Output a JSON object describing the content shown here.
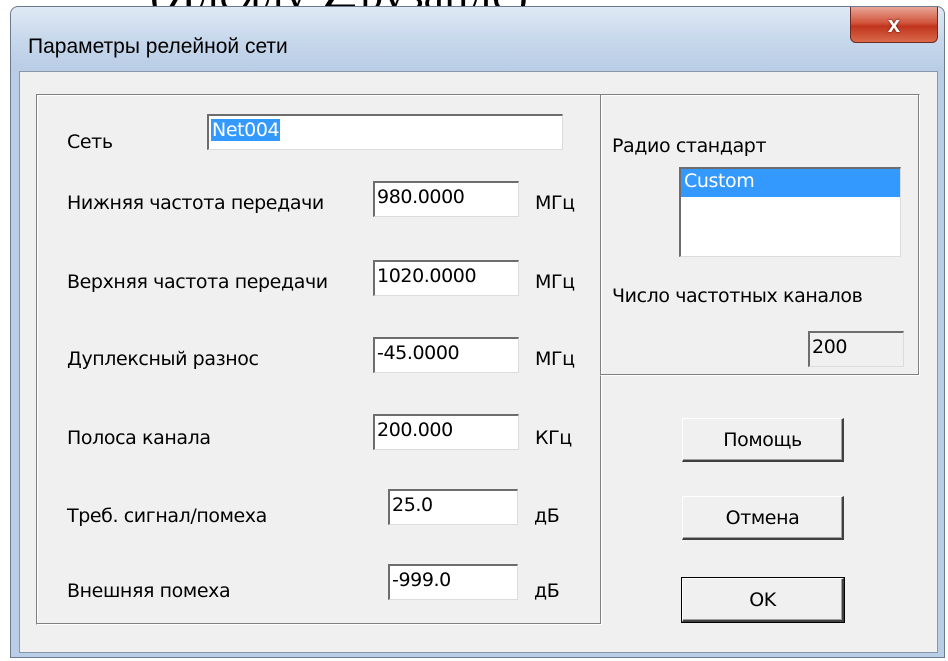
{
  "page_top_clip": "(Ядеяду ∠рузанде)",
  "window": {
    "title": "Параметры релейной сети",
    "close_glyph": "x"
  },
  "network": {
    "label": "Сеть",
    "value": "Net004"
  },
  "params": [
    {
      "label": "Нижняя частота передачи",
      "value": "980.0000",
      "unit": "МГц"
    },
    {
      "label": "Верхняя частота передачи",
      "value": "1020.0000",
      "unit": "МГц"
    },
    {
      "label": "Дуплексный разнос",
      "value": "-45.0000",
      "unit": "МГц"
    },
    {
      "label": "Полоса канала",
      "value": "200.000",
      "unit": "КГц"
    },
    {
      "label": "Треб. сигнал/помеха",
      "value": "25.0",
      "unit": "дБ"
    },
    {
      "label": "Внешняя помеха",
      "value": "-999.0",
      "unit": "дБ"
    }
  ],
  "radio": {
    "label": "Радио стандарт",
    "options": [
      "Custom"
    ],
    "selected": "Custom",
    "channels_label": "Число частотных каналов",
    "channels_value": "200"
  },
  "buttons": {
    "help": "Помощь",
    "cancel": "Отмена",
    "ok": "OK"
  }
}
